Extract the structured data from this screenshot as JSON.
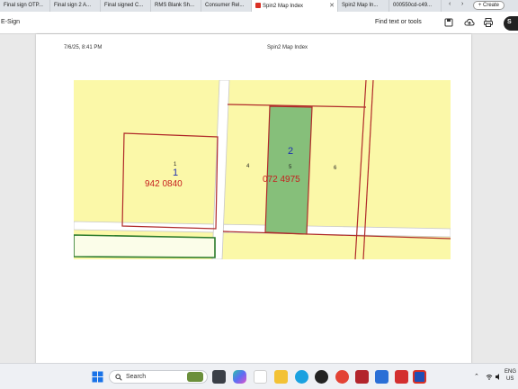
{
  "browser": {
    "tabs": [
      {
        "label": "Final sign OTP...",
        "active": false
      },
      {
        "label": "Final sign 2 A...",
        "active": false
      },
      {
        "label": "Final signed C...",
        "active": false
      },
      {
        "label": "RMS Blank Sh...",
        "active": false
      },
      {
        "label": "Consumer Rel...",
        "active": false
      },
      {
        "label": "Spin2 Map Index",
        "active": true
      },
      {
        "label": "Spin2 Map In...",
        "active": false
      },
      {
        "label": "000550cd-c49...",
        "active": false
      }
    ],
    "create_label": "+ Create"
  },
  "toolbar": {
    "app_label": "E-Sign",
    "find_label": "Find text or tools"
  },
  "document": {
    "header_date": "7/6/25, 8:41 PM",
    "header_title": "Spin2 Map Index",
    "map": {
      "lot_1_number": "1",
      "lot_1_small": "1",
      "lot_1_id": "942 0840",
      "lot_2_number": "2",
      "lot_2_small": "5",
      "lot_2_id": "072 4975",
      "lot_4_small": "4",
      "lot_6_small": "6",
      "colors": {
        "land": "#fbf8a8",
        "highlight": "#86bf7a",
        "boundary": "#b02a2a",
        "lot_1_text": "#1e2fb0",
        "id_text": "#c61f1f"
      }
    }
  },
  "taskbar": {
    "search_placeholder": "Search",
    "lang_line1": "ENG",
    "lang_line2": "US"
  }
}
